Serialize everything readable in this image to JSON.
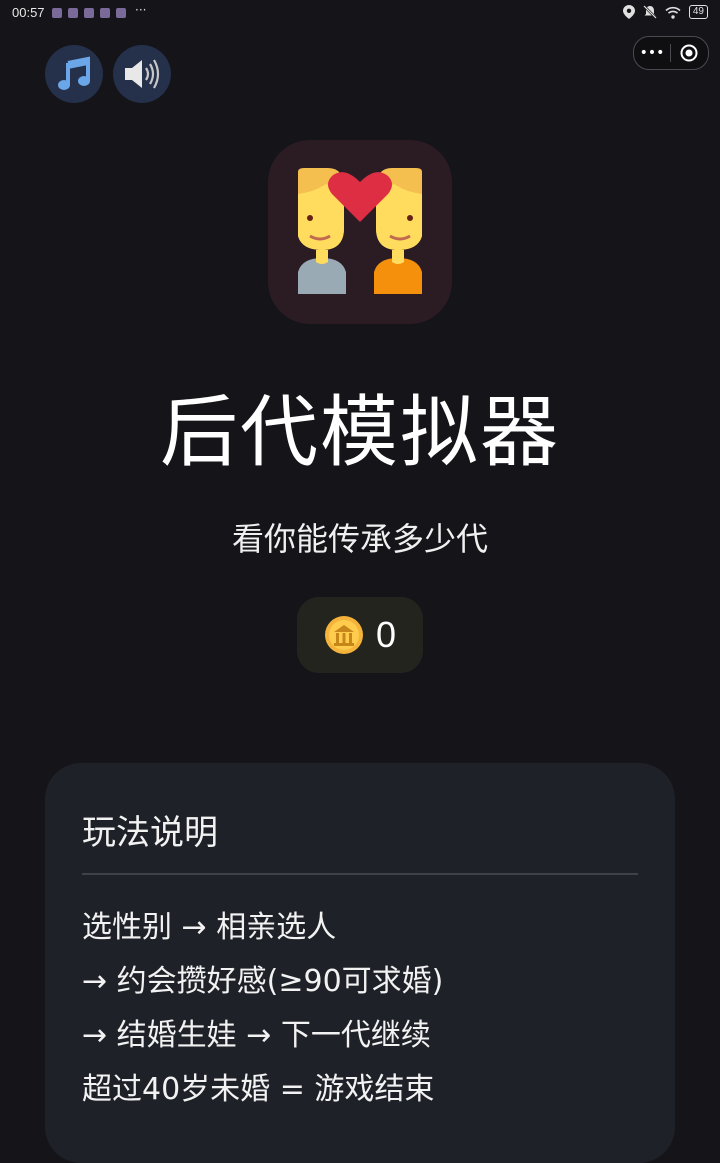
{
  "status_bar": {
    "time": "00:57",
    "more": "···",
    "battery": "49"
  },
  "buttons": {
    "music_icon": "music-note-icon",
    "sound_icon": "speaker-icon"
  },
  "capsule": {
    "menu": "•••",
    "close_icon": "target-icon"
  },
  "app": {
    "title": "后代模拟器",
    "subtitle": "看你能传承多少代",
    "logo_icon": "couple-with-heart-icon",
    "coins": {
      "icon": "coin-icon",
      "value": "0"
    }
  },
  "instructions": {
    "title": "玩法说明",
    "rules": [
      "选性别 → 相亲选人",
      "→ 约会攒好感(≥90可求婚)",
      "→ 结婚生娃 → 下一代继续",
      "超过40岁未婚 = 游戏结束"
    ]
  },
  "colors": {
    "background": "#141419",
    "card": "#1e2128",
    "button": "#25304a",
    "coin_pill": "#24241f",
    "heart": "#dd2e44"
  }
}
